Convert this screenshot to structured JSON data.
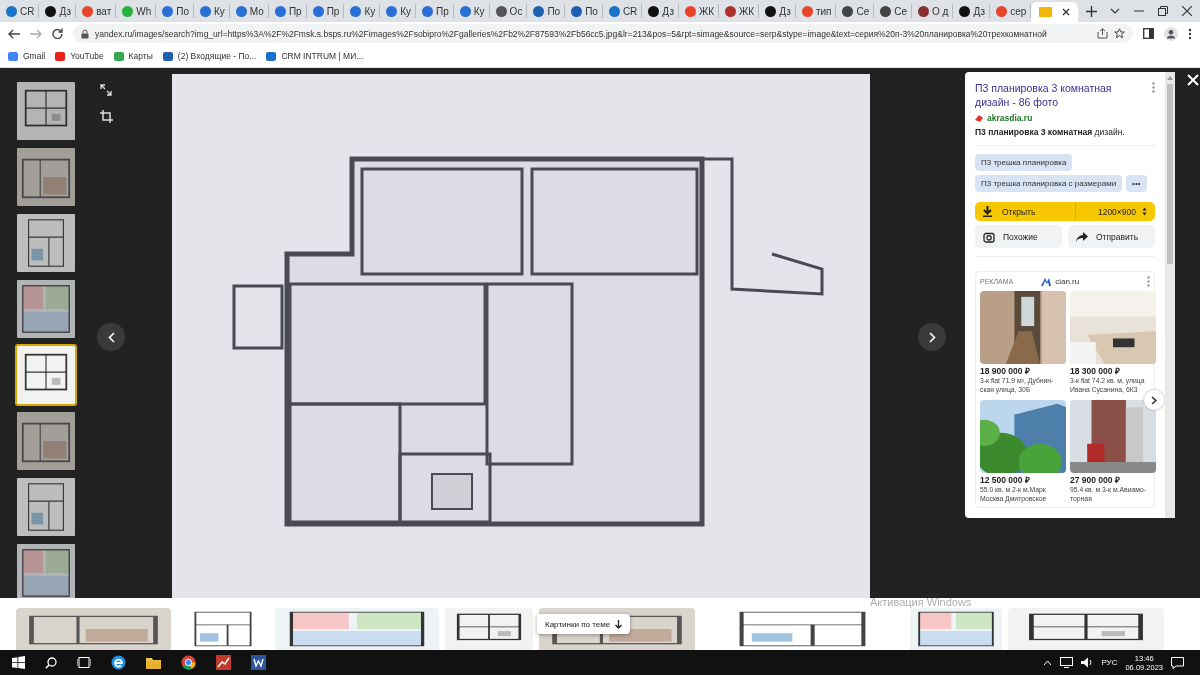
{
  "browser": {
    "tabs": [
      {
        "title": "CR",
        "selected": false,
        "color": "#1a73c8"
      },
      {
        "title": "Дз",
        "selected": false,
        "color": "#111111"
      },
      {
        "title": "ват",
        "selected": false,
        "color": "#e8442c"
      },
      {
        "title": "Wh",
        "selected": false,
        "color": "#25b33f"
      },
      {
        "title": "По",
        "selected": false,
        "color": "#2a6fd6"
      },
      {
        "title": "Ку",
        "selected": false,
        "color": "#2a6fd6"
      },
      {
        "title": "Мо",
        "selected": false,
        "color": "#2a6fd6"
      },
      {
        "title": "Пр",
        "selected": false,
        "color": "#2a6fd6"
      },
      {
        "title": "Пр",
        "selected": false,
        "color": "#2a6fd6"
      },
      {
        "title": "Ку",
        "selected": false,
        "color": "#2a6fd6"
      },
      {
        "title": "Ку",
        "selected": false,
        "color": "#2a6fd6"
      },
      {
        "title": "Пр",
        "selected": false,
        "color": "#2a6fd6"
      },
      {
        "title": "Ку",
        "selected": false,
        "color": "#2a6fd6"
      },
      {
        "title": "Ос",
        "selected": false,
        "color": "#555555"
      },
      {
        "title": "По",
        "selected": false,
        "color": "#1e5fae"
      },
      {
        "title": "По",
        "selected": false,
        "color": "#1e5fae"
      },
      {
        "title": "CR",
        "selected": false,
        "color": "#1a73c8"
      },
      {
        "title": "Дз",
        "selected": false,
        "color": "#111111"
      },
      {
        "title": "ЖК",
        "selected": false,
        "color": "#e8442c"
      },
      {
        "title": "ЖК",
        "selected": false,
        "color": "#b03030"
      },
      {
        "title": "Дз",
        "selected": false,
        "color": "#111111"
      },
      {
        "title": "тип",
        "selected": false,
        "color": "#e8442c"
      },
      {
        "title": "Се",
        "selected": false,
        "color": "#444444"
      },
      {
        "title": "Се",
        "selected": false,
        "color": "#444444"
      },
      {
        "title": "О д",
        "selected": false,
        "color": "#8a3030"
      },
      {
        "title": "Дз",
        "selected": false,
        "color": "#111111"
      },
      {
        "title": "сер",
        "selected": false,
        "color": "#e8442c"
      },
      {
        "selected": true,
        "color": "#f2b705"
      }
    ],
    "address": "yandex.ru/images/search?img_url=https%3A%2F%2Fmsk.s.bsps.ru%2Fimages%2Fsobipro%2Fgalleries%2Fb2%2F87593%2Fb56cc5.jpg&lr=213&pos=5&rpt=simage&source=serp&stype=image&text=серия%20п-3%20планировка%20трехкомнатной",
    "bookmarks": [
      {
        "label": "Gmail",
        "color": "#4285f4"
      },
      {
        "label": "YouTube",
        "color": "#e62117"
      },
      {
        "label": "Карты",
        "color": "#34a853"
      },
      {
        "label": "(2) Входящие - По...",
        "color": "#1e5fae"
      },
      {
        "label": "CRM INTRUM | МИ...",
        "color": "#1a73c8"
      }
    ]
  },
  "viewer": {
    "thumbnails": [
      {
        "selected": false
      },
      {
        "selected": false
      },
      {
        "selected": false
      },
      {
        "selected": false
      },
      {
        "selected": true
      },
      {
        "selected": false
      },
      {
        "selected": false
      },
      {
        "selected": false
      }
    ],
    "panel": {
      "title": "П3 планировка 3 комнатная дизайн - 86 фото",
      "site": "akrasdia.ru",
      "snippet": "**П3 планировка 3 комнатная** дизайн.",
      "tags": [
        "П3 трешка планировка",
        "П3 трешка планировка с размерами"
      ],
      "more": "•••",
      "open": {
        "label": "Открыть",
        "size": "1200×900"
      },
      "similar": "Похожие",
      "share": "Отправить",
      "ad": {
        "label": "РЕКЛАМА",
        "source": "cian.ru",
        "items": [
          {
            "price": "18 900 000 ₽",
            "description": "3-к flat 71.9 м², Дубнин-ская улица, 30Б"
          },
          {
            "price": "18 300 000 ₽",
            "description": "3-к flat 74.2 кв. м, улица Ивана Сусанина, 6К3"
          },
          {
            "price": "12 500 000 ₽",
            "description": "55.0 кв. м 2-к м.Марк Москва Дмитровское"
          },
          {
            "price": "27 900 000 ₽",
            "description": "95.4 кв. м 3-к м.Авиамо-торная"
          }
        ]
      }
    },
    "related": {
      "button": "Картинки по теме"
    }
  },
  "system": {
    "activation": "Активация Windows",
    "language": "РУС",
    "time": "13:46",
    "date": "06.09.2023"
  }
}
